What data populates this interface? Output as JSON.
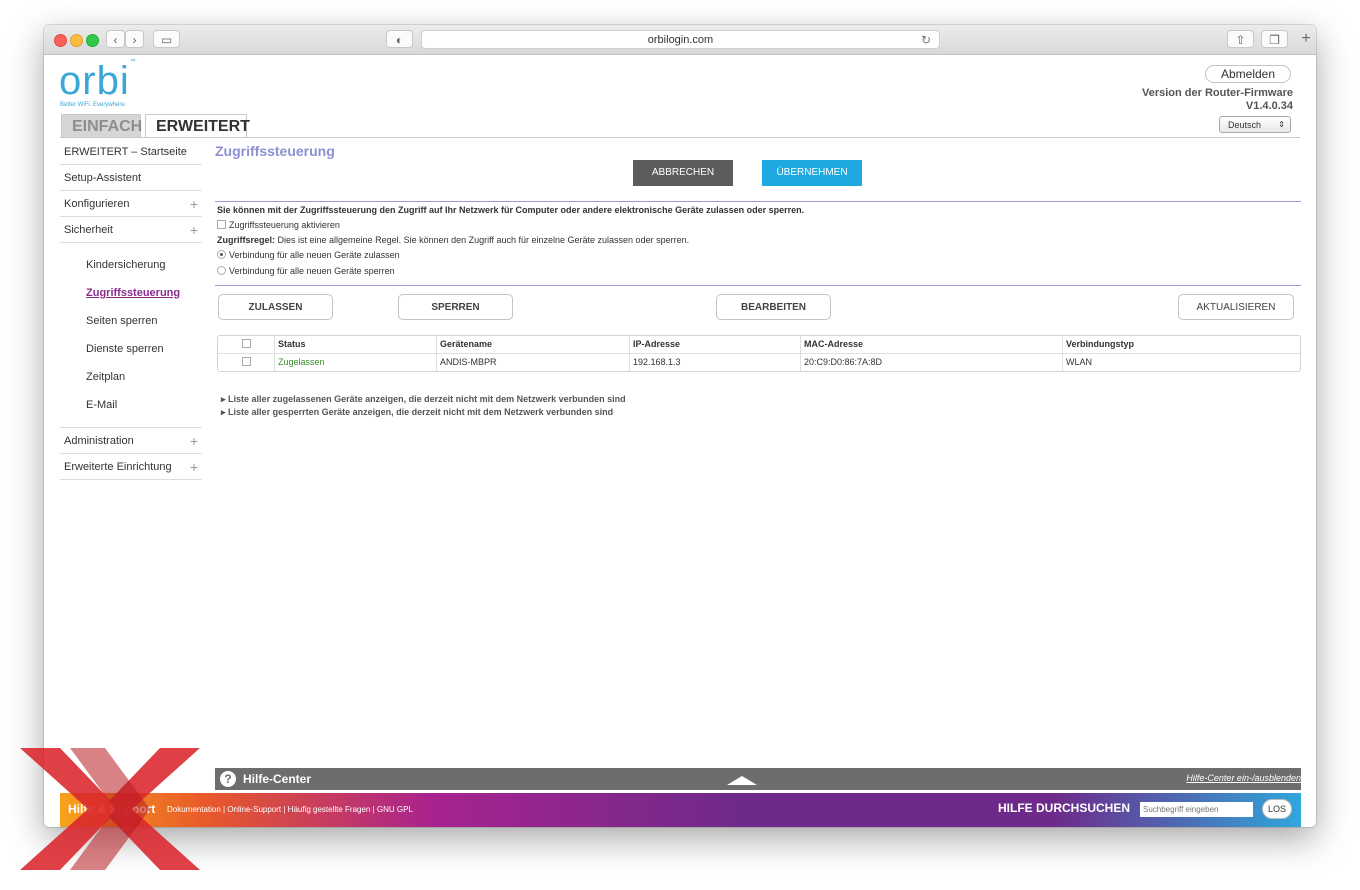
{
  "browser": {
    "url": "orbilogin.com"
  },
  "header": {
    "logo": "orbi",
    "logo_tm": "™",
    "tagline": "Better WiFi. Everywhere.",
    "tabs": [
      "EINFACH",
      "ERWEITERT"
    ],
    "logout": "Abmelden",
    "firmware_label": "Version der Router-Firmware",
    "firmware_version": "V1.4.0.34",
    "language": "Deutsch"
  },
  "sidebar": {
    "top_items": [
      {
        "label": "ERWEITERT – Startseite",
        "expandable": false
      },
      {
        "label": "Setup-Assistent",
        "expandable": false
      },
      {
        "label": "Konfigurieren",
        "expandable": true
      },
      {
        "label": "Sicherheit",
        "expandable": true
      }
    ],
    "sub_items": [
      "Kindersicherung",
      "Zugriffssteuerung",
      "Seiten sperren",
      "Dienste sperren",
      "Zeitplan",
      "E-Mail"
    ],
    "active_sub": "Zugriffssteuerung",
    "bottom_items": [
      {
        "label": "Administration",
        "expandable": true
      },
      {
        "label": "Erweiterte Einrichtung",
        "expandable": true
      }
    ],
    "plus_symbol": "+"
  },
  "main": {
    "title": "Zugriffssteuerung",
    "cancel": "ABBRECHEN",
    "apply": "ÜBERNEHMEN",
    "intro": "Sie können mit der Zugriffssteuerung den Zugriff auf Ihr Netzwerk für Computer oder andere elektronische Geräte zulassen oder sperren.",
    "enable_checkbox": "Zugriffssteuerung aktivieren",
    "rule_label": "Zugriffsregel:",
    "rule_text": " Dies ist eine allgemeine Regel. Sie können den Zugriff auch für einzelne Geräte zulassen oder sperren.",
    "radio_allow": "Verbindung für alle neuen Geräte zulassen",
    "radio_block": "Verbindung für alle neuen Geräte sperren",
    "btn_allow": "ZULASSEN",
    "btn_block": "SPERREN",
    "btn_edit": "BEARBEITEN",
    "btn_refresh": "AKTUALISIEREN",
    "table": {
      "columns": [
        "Status",
        "Gerätename",
        "IP-Adresse",
        "MAC-Adresse",
        "Verbindungstyp"
      ],
      "rows": [
        {
          "status": "Zugelassen",
          "name": "ANDIS-MBPR",
          "ip": "192.168.1.3",
          "mac": "20:C9:D0:86:7A:8D",
          "type": "WLAN"
        }
      ]
    },
    "list_allowed": "Liste aller zugelassenen Geräte anzeigen, die derzeit nicht mit dem Netzwerk verbunden sind",
    "list_blocked": "Liste aller gesperrten Geräte anzeigen, die derzeit nicht mit dem Netzwerk verbunden sind",
    "triangle": "▸"
  },
  "helpbar": {
    "icon": "?",
    "title": "Hilfe-Center",
    "toggle": "Hilfe-Center ein-/ausblenden"
  },
  "footer": {
    "title": "Hilfe & Support",
    "links": "Dokumentation | Online-Support | Häufig gestellte Fragen | GNU GPL",
    "search_label": "HILFE DURCHSUCHEN",
    "search_placeholder": "Suchbegriff eingeben",
    "search_button": "LOS"
  },
  "colors": {
    "accent_blue": "#1fa9e1",
    "title_purple": "#8d8fd2",
    "active_link": "#8a2c8f",
    "status_green": "#3a8c2c",
    "watermark_red": "#d9262b"
  }
}
